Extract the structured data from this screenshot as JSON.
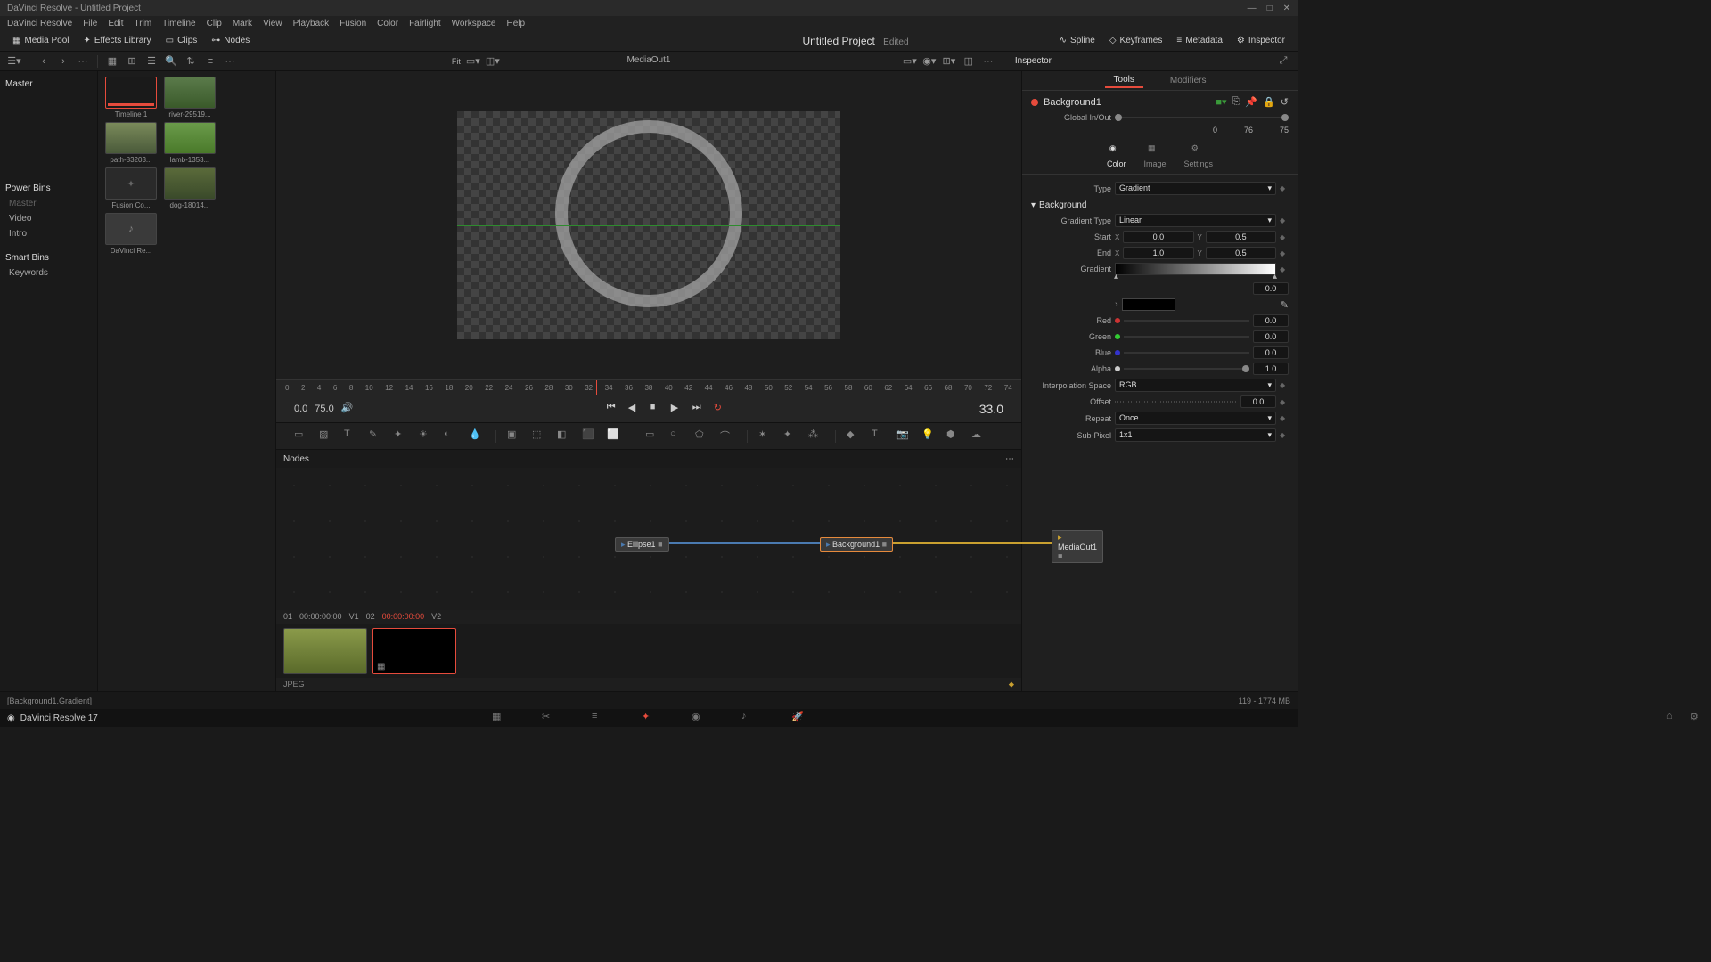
{
  "app": {
    "title": "DaVinci Resolve - Untitled Project"
  },
  "menus": [
    "DaVinci Resolve",
    "File",
    "Edit",
    "Trim",
    "Timeline",
    "Clip",
    "Mark",
    "View",
    "Playback",
    "Fusion",
    "Color",
    "Fairlight",
    "Workspace",
    "Help"
  ],
  "toolbar": {
    "media_pool": "Media Pool",
    "effects_library": "Effects Library",
    "clips": "Clips",
    "nodes": "Nodes",
    "spline": "Spline",
    "keyframes": "Keyframes",
    "metadata": "Metadata",
    "inspector": "Inspector",
    "project_title": "Untitled Project",
    "edited": "Edited"
  },
  "subtoolbar": {
    "fit": "Fit"
  },
  "bins": {
    "master": "Master",
    "power_bins": "Power Bins",
    "items": [
      "Master",
      "Video",
      "Intro"
    ],
    "smart_bins": "Smart Bins",
    "keywords": "Keywords"
  },
  "clips": [
    {
      "label": "Timeline 1"
    },
    {
      "label": "river-29519..."
    },
    {
      "label": "path-83203..."
    },
    {
      "label": "lamb-1353..."
    },
    {
      "label": "Fusion Co..."
    },
    {
      "label": "dog-18014..."
    },
    {
      "label": "DaVinci Re..."
    }
  ],
  "viewer": {
    "title": "MediaOut1"
  },
  "ruler_marks": [
    "0",
    "2",
    "4",
    "6",
    "8",
    "10",
    "12",
    "14",
    "16",
    "18",
    "20",
    "22",
    "24",
    "26",
    "28",
    "30",
    "32",
    "34",
    "36",
    "38",
    "40",
    "42",
    "44",
    "46",
    "48",
    "50",
    "52",
    "54",
    "56",
    "58",
    "60",
    "62",
    "64",
    "66",
    "68",
    "70",
    "72",
    "74"
  ],
  "transport": {
    "start": "0.0",
    "end": "75.0",
    "current": "33.0"
  },
  "nodes_panel": {
    "title": "Nodes"
  },
  "nodes": {
    "n1": "Ellipse1",
    "n2": "Background1",
    "n3": "MediaOut1"
  },
  "bottom_clips": {
    "c1_idx": "01",
    "c1_tc": "00:00:00:00",
    "c1_track": "V1",
    "c2_idx": "02",
    "c2_tc": "00:00:00:00",
    "c2_track": "V2",
    "format": "JPEG"
  },
  "inspector": {
    "title": "Inspector",
    "tabs": {
      "tools": "Tools",
      "modifiers": "Modifiers"
    },
    "node_name": "Background1",
    "global": {
      "label": "Global In/Out",
      "in": "0",
      "mid": "76",
      "out": "75"
    },
    "subtabs": {
      "color": "Color",
      "image": "Image",
      "settings": "Settings"
    },
    "type_label": "Type",
    "type_value": "Gradient",
    "section_background": "Background",
    "gradient_type_label": "Gradient Type",
    "gradient_type_value": "Linear",
    "start_label": "Start",
    "start_x": "0.0",
    "start_y": "0.5",
    "end_label": "End",
    "end_x": "1.0",
    "end_y": "0.5",
    "gradient_label": "Gradient",
    "gradient_pos": "0.0",
    "red_label": "Red",
    "red_val": "0.0",
    "green_label": "Green",
    "green_val": "0.0",
    "blue_label": "Blue",
    "blue_val": "0.0",
    "alpha_label": "Alpha",
    "alpha_val": "1.0",
    "interp_label": "Interpolation Space",
    "interp_val": "RGB",
    "offset_label": "Offset",
    "offset_val": "0.0",
    "repeat_label": "Repeat",
    "repeat_val": "Once",
    "subpixel_label": "Sub-Pixel",
    "subpixel_val": "1x1"
  },
  "status": {
    "hint": "[Background1.Gradient]",
    "memory": "119 - 1774 MB"
  },
  "bottomnav": {
    "app_name": "DaVinci Resolve 17"
  }
}
